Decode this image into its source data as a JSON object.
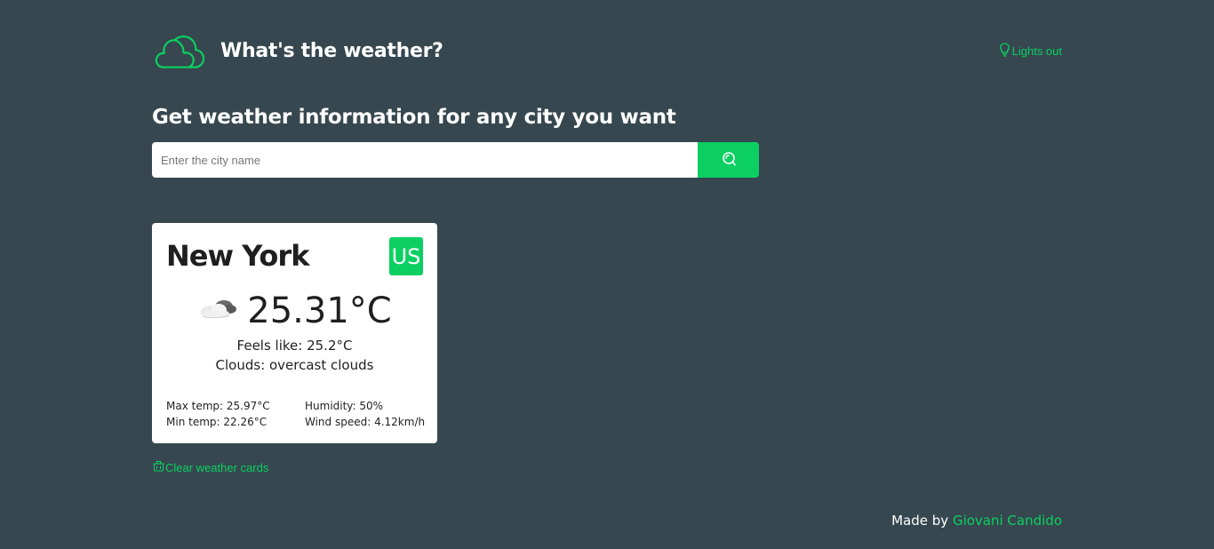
{
  "header": {
    "title": "What's the weather?",
    "logo_icon": "cloud-icon",
    "lights_out_label": "Lights out",
    "lights_out_icon": "lightbulb-icon"
  },
  "search": {
    "heading": "Get weather information for any city you want",
    "placeholder": "Enter the city name",
    "value": "",
    "button_icon": "search-icon"
  },
  "cards": [
    {
      "city": "New York",
      "country": "US",
      "icon": "overcast-clouds-icon",
      "temperature": "25.31°C",
      "feels_like": "Feels like: 25.2°C",
      "clouds": "Clouds: overcast clouds",
      "max_temp": "Max temp: 25.97°C",
      "min_temp": "Min temp: 22.26°C",
      "humidity": "Humidity: 50%",
      "wind_speed": "Wind speed: 4.12km/h"
    }
  ],
  "clear": {
    "label": "Clear weather cards",
    "icon": "trash-icon"
  },
  "footer": {
    "made_by": "Made by",
    "author": "Giovani Candido"
  },
  "colors": {
    "background": "#36474f",
    "accent": "#0bd061",
    "card": "#ffffff"
  }
}
